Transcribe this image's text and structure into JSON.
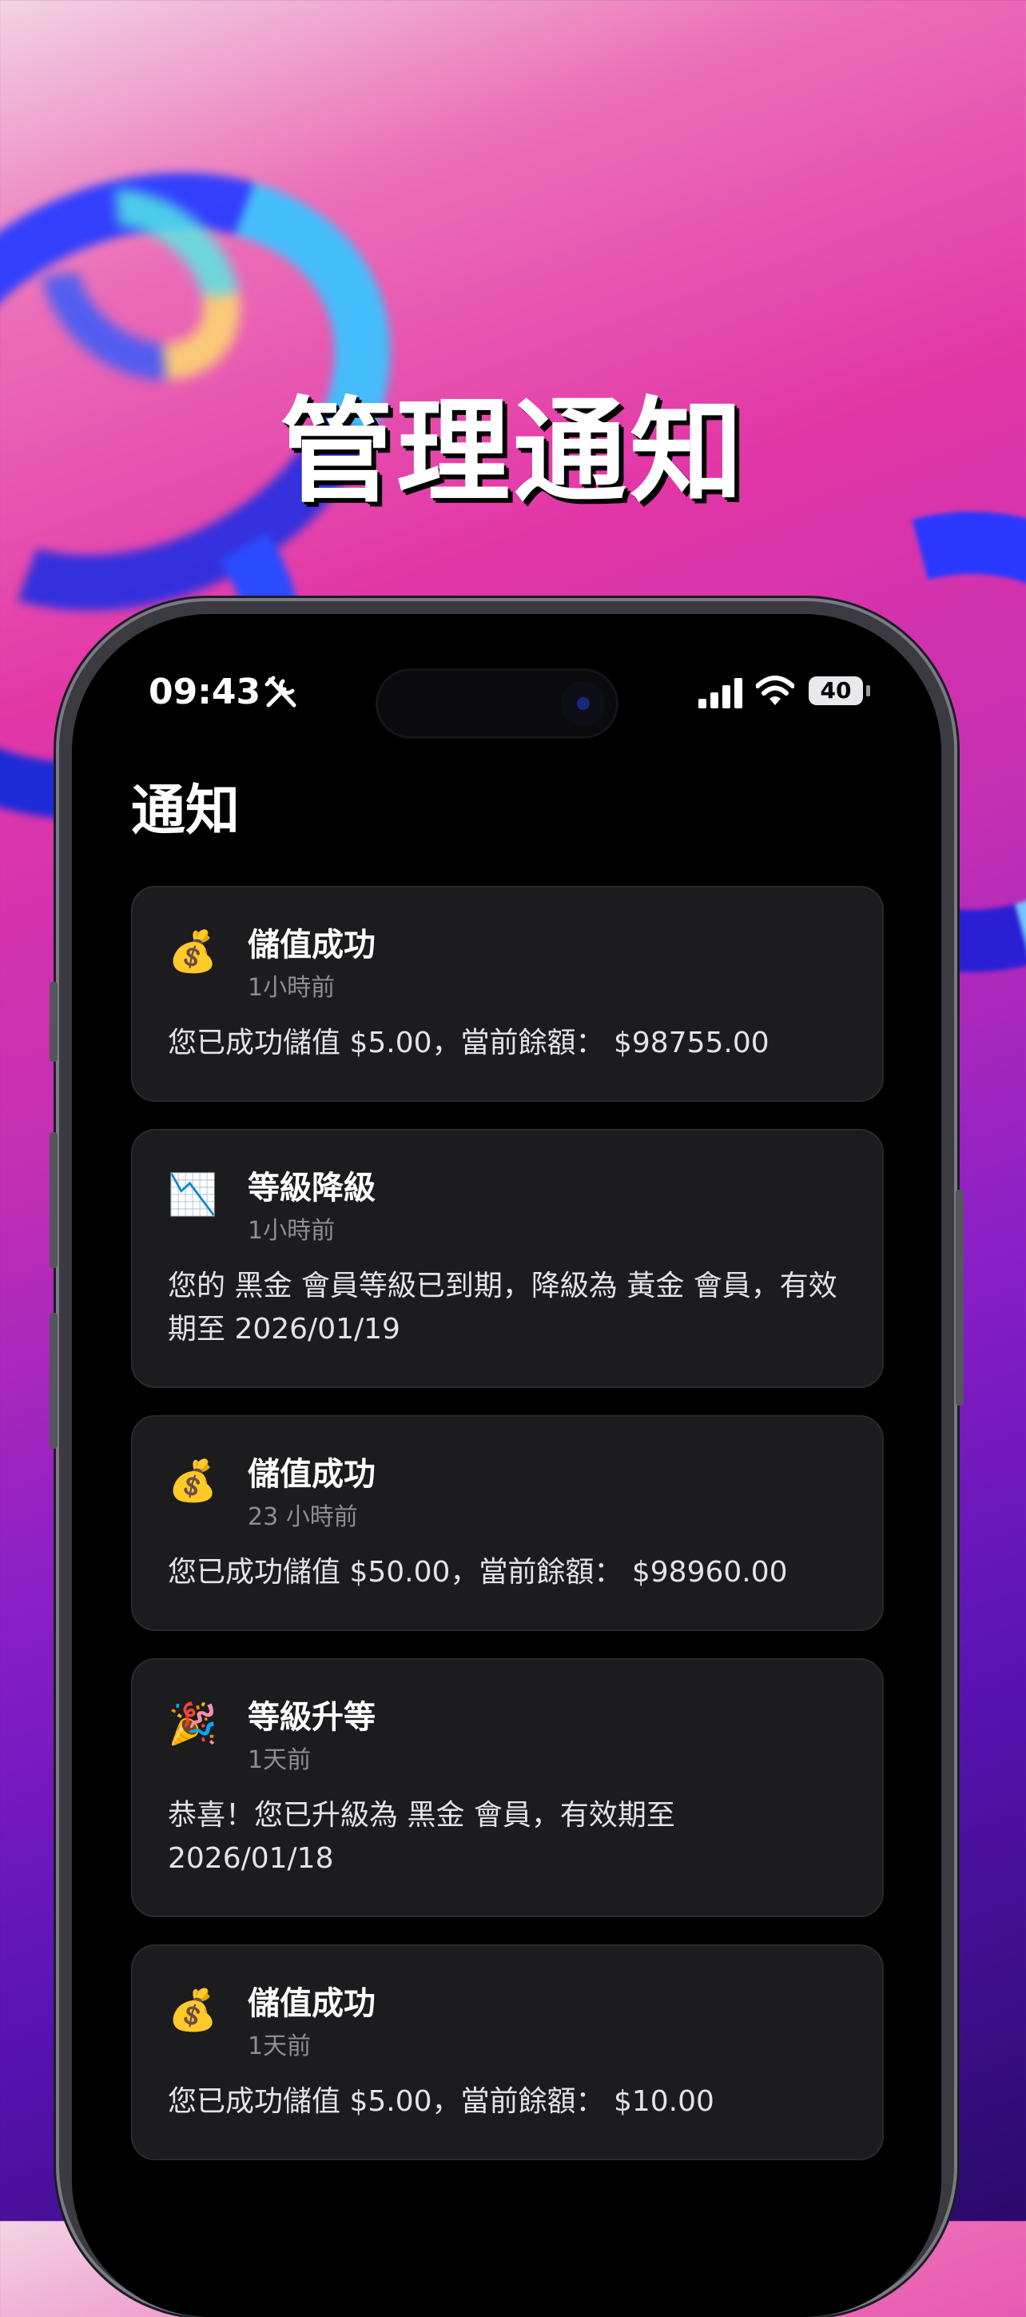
{
  "headline": "管理通知",
  "status_bar": {
    "time": "09:43",
    "battery": "40"
  },
  "page": {
    "title": "通知"
  },
  "notifications": [
    {
      "icon": "money-bag-icon",
      "emoji": "💰",
      "title": "儲值成功",
      "time": "1小時前",
      "message": "您已成功儲值 $5.00，當前餘額： $98755.00"
    },
    {
      "icon": "chart-decreasing-icon",
      "emoji": "📉",
      "title": "等級降級",
      "time": "1小時前",
      "message": "您的 黑金 會員等級已到期，降級為 黃金 會員，有效期至 2026/01/19"
    },
    {
      "icon": "money-bag-icon",
      "emoji": "💰",
      "title": "儲值成功",
      "time": "23 小時前",
      "message": "您已成功儲值 $50.00，當前餘額： $98960.00"
    },
    {
      "icon": "party-popper-icon",
      "emoji": "🎉",
      "title": "等級升等",
      "time": "1天前",
      "message": "恭喜！您已升級為 黑金 會員，有效期至 2026/01/18"
    },
    {
      "icon": "money-bag-icon",
      "emoji": "💰",
      "title": "儲值成功",
      "time": "1天前",
      "message": "您已成功儲值 $5.00，當前餘額： $10.00"
    }
  ]
}
